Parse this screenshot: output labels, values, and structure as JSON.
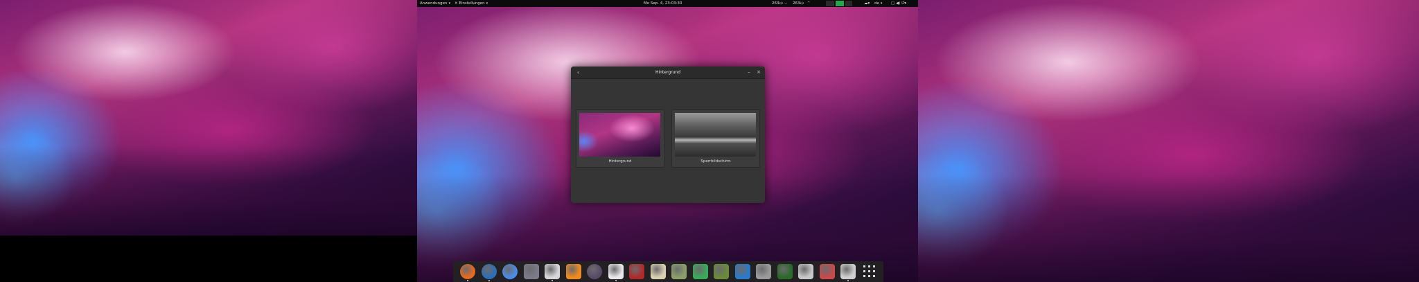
{
  "topbar": {
    "applications": "Anwendungen",
    "settings": "Einstellungen",
    "clock": "Mo Sep. 4, 23:03:30",
    "net_down": "263",
    "net_up": "263",
    "keyboard": "de"
  },
  "window": {
    "title": "Hintergrund",
    "tiles": [
      {
        "label": "Hintergrund"
      },
      {
        "label": "Sperrbildschirm"
      }
    ]
  },
  "dock": {
    "apps": [
      {
        "name": "firefox-icon",
        "color": "#e66a1f",
        "running": true
      },
      {
        "name": "thunderbird-icon",
        "color": "#2a6fb8",
        "running": true
      },
      {
        "name": "chromium-icon",
        "color": "#4a8de8",
        "running": false
      },
      {
        "name": "chat-icon",
        "color": "#7a7a8a",
        "running": false
      },
      {
        "name": "phone-icon",
        "color": "#d8d8d8",
        "running": true
      },
      {
        "name": "vlc-icon",
        "color": "#f08a1c",
        "running": false
      },
      {
        "name": "music-player-icon",
        "color": "#5a4a6a",
        "running": false
      },
      {
        "name": "files-icon",
        "color": "#e8e8e8",
        "running": true
      },
      {
        "name": "monitor-icon",
        "color": "#b02a2a",
        "running": false
      },
      {
        "name": "text-editor-icon",
        "color": "#d8d0b0",
        "running": false
      },
      {
        "name": "calculator-icon",
        "color": "#8aa06a",
        "running": false
      },
      {
        "name": "tools-icon",
        "color": "#3aaa5a",
        "running": false
      },
      {
        "name": "archive-icon",
        "color": "#6a8a3a",
        "running": false
      },
      {
        "name": "system-monitor-icon",
        "color": "#2a7ac8",
        "running": false
      },
      {
        "name": "font-viewer-icon",
        "color": "#9a9a9a",
        "running": false
      },
      {
        "name": "terminal-graph-icon",
        "color": "#2a6a2a",
        "running": false
      },
      {
        "name": "search-docs-icon",
        "color": "#c8c8c8",
        "running": false
      },
      {
        "name": "installer-icon",
        "color": "#c84a4a",
        "running": false
      },
      {
        "name": "settings-icon",
        "color": "#d0d0d0",
        "running": true
      },
      {
        "name": "app-grid-icon",
        "color": "#dddddd",
        "running": false
      }
    ]
  }
}
